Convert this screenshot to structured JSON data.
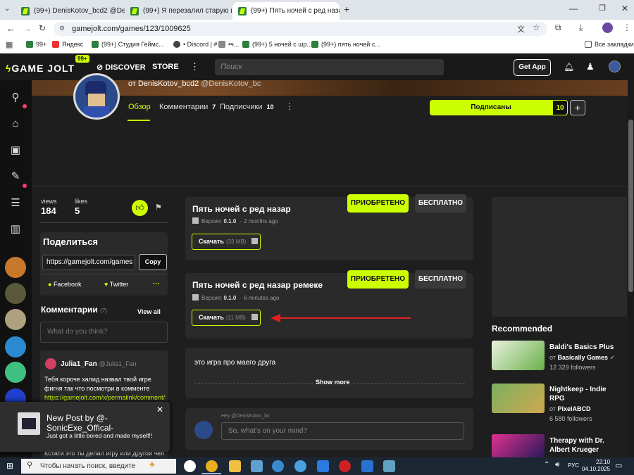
{
  "browser": {
    "tabs": [
      {
        "label": "(99+) DenisKotov_bcd2 @Denis"
      },
      {
        "label": "(99+) Я перезалил старую вер"
      },
      {
        "label": "(99+) Пять ночей с ред назар"
      }
    ],
    "url": "gamejolt.com/games/123/1009625",
    "bookmarks": [
      "99+",
      "Яндекс",
      "(99+) Студия Геймс...",
      "• Discord | #",
      "•ч...",
      "(99+) 5 ночей с шр...",
      "(99+) пять ночей с..."
    ],
    "all_bookmarks": "Все закладки"
  },
  "nav": {
    "logo": "GAME JOLT",
    "badge": "99+",
    "discover": "DISCOVER",
    "store": "STORE",
    "search_placeholder": "Поиск",
    "get_app": "Get App"
  },
  "profile": {
    "author": "от DenisKotov_bcd2",
    "handle": "@DenisKotov_bc",
    "tabs": [
      {
        "label": "Обзор"
      },
      {
        "label": "Комментарии",
        "count": "7"
      },
      {
        "label": "Подписчики",
        "count": "10"
      }
    ],
    "subscribed": "Подписаны",
    "sub_count": "10"
  },
  "stats": {
    "views_label": "views",
    "views": "184",
    "likes_label": "likes",
    "likes": "5"
  },
  "share": {
    "title": "Поделиться",
    "url": "https://gamejolt.com/games",
    "copy": "Copy",
    "facebook": "Facebook",
    "twitter": "Twitter",
    "more": "···"
  },
  "comments": {
    "title": "Комментарии",
    "count": "(7)",
    "view_all": "View all",
    "placeholder": "What do you think?",
    "first": {
      "user": "Julia1_Fan",
      "handle": "@Julia1_Fan",
      "text": "Тебя короче халид назвал твой игре фигня так что посмотри в комменте",
      "link": "https://gamejolt.com/x/permalink/comment/3",
      "extra": "Кстати это ты делал игру или другой чел"
    }
  },
  "builds": [
    {
      "title": "Пять ночей с ред назар",
      "version_label": "Версия:",
      "version": "0.1.0",
      "age": "2 months ago",
      "owned": "ПРИОБРЕТЕНО",
      "free": "БЕСПЛАТНО",
      "download": "Скачать",
      "size": "(33 MB)"
    },
    {
      "title": "Пять ночей с ред назар ремеке",
      "version_label": "Версия:",
      "version": "0.1.0",
      "age": "6 minutes ago",
      "owned": "ПРИОБРЕТЕНО",
      "free": "БЕСПЛАТНО",
      "download": "Скачать",
      "size": "(11 MB)"
    }
  ],
  "description": {
    "text": "это игра про маего друга",
    "show_more": "Show more"
  },
  "post": {
    "label": "Hey @DenisKotov_bc",
    "placeholder": "So, what's on your mind?"
  },
  "recommended": {
    "title": "Recommended",
    "items": [
      {
        "name": "Baldi's Basics Plus",
        "by": "от",
        "author": "Basically Games",
        "followers": "12 329 followers",
        "color": "#4a9a3a"
      },
      {
        "name": "Nightkeep - Indie RPG",
        "by": "от",
        "author": "PixelABCD",
        "followers": "6 580 followers",
        "color": "#c7a240"
      },
      {
        "name": "Therapy with Dr. Albert Krueger",
        "by": "",
        "author": "",
        "followers": "",
        "color": "#c8207a"
      }
    ]
  },
  "toast": {
    "title": "New Post by @-SonicExe_Offical-",
    "body": "Just got a little bored and made myself!!",
    "close": "✕"
  },
  "taskbar": {
    "search": "Чтобы начать поиск, введите",
    "lang": "РУС",
    "time": "22:10",
    "date": "04.10.2025"
  }
}
